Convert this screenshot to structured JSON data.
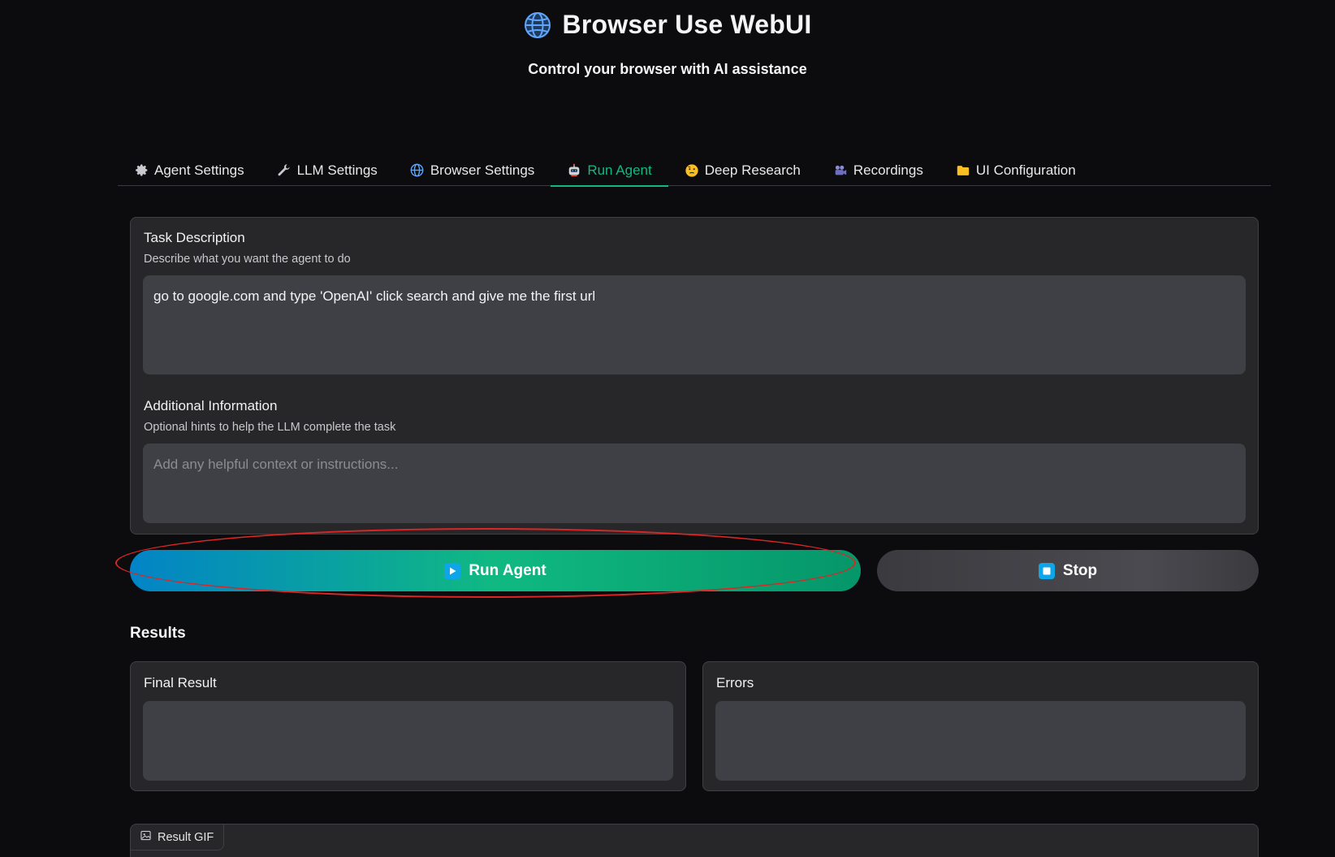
{
  "header": {
    "title": "Browser Use WebUI",
    "subtitle": "Control your browser with AI assistance"
  },
  "tabs": [
    {
      "label": "Agent Settings",
      "icon": "gear-icon"
    },
    {
      "label": "LLM Settings",
      "icon": "wrench-icon"
    },
    {
      "label": "Browser Settings",
      "icon": "globe-icon"
    },
    {
      "label": "Run Agent",
      "icon": "robot-icon",
      "active": true
    },
    {
      "label": "Deep Research",
      "icon": "thinking-face-icon"
    },
    {
      "label": "Recordings",
      "icon": "movie-camera-icon"
    },
    {
      "label": "UI Configuration",
      "icon": "folder-icon"
    }
  ],
  "task": {
    "label": "Task Description",
    "info": "Describe what you want the agent to do",
    "value": "go to google.com and type 'OpenAI' click search and give me the first url"
  },
  "additional": {
    "label": "Additional Information",
    "info": "Optional hints to help the LLM complete the task",
    "placeholder": "Add any helpful context or instructions..."
  },
  "buttons": {
    "run_label": "Run Agent",
    "stop_label": "Stop"
  },
  "results": {
    "heading": "Results",
    "final_label": "Final Result",
    "errors_label": "Errors",
    "gif_label": "Result GIF"
  },
  "colors": {
    "accent": "#10b981",
    "highlight": "#dc2626"
  }
}
